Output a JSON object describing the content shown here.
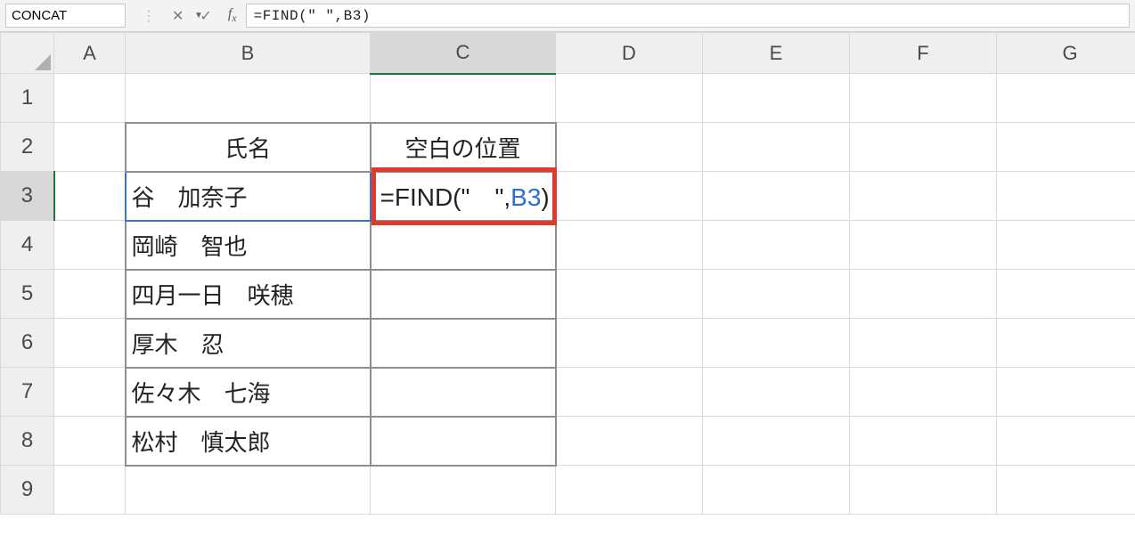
{
  "name_box": {
    "value": "CONCAT"
  },
  "formula_bar": {
    "text": "=FIND(\"   \",B3)"
  },
  "columns": [
    "A",
    "B",
    "C",
    "D",
    "E",
    "F",
    "G"
  ],
  "active_col": "C",
  "rows": [
    1,
    2,
    3,
    4,
    5,
    6,
    7,
    8,
    9
  ],
  "active_row": 3,
  "table": {
    "header_b": "氏名",
    "header_c": "空白の位置",
    "names": [
      "谷　加奈子",
      "岡崎　智也",
      "四月一日　咲穂",
      "厚木　忍",
      "佐々木　七海",
      "松村　慎太郎"
    ]
  },
  "edit_cell": {
    "prefix": "=FIND(\"　\",",
    "ref": "B3",
    "suffix": ")"
  }
}
